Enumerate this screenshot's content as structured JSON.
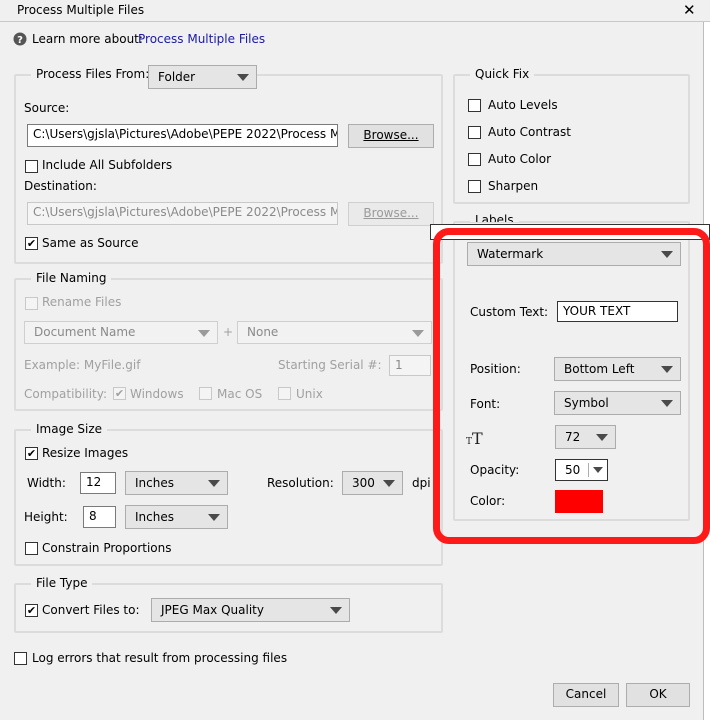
{
  "window": {
    "title": "Process Multiple Files",
    "close_glyph": "✕"
  },
  "help": {
    "prefix": "Learn more about:",
    "link": "Process Multiple Files",
    "icon": "question-circle-icon"
  },
  "process_from": {
    "legend": "Process Files From:",
    "selected": "Folder",
    "source_label": "Source:",
    "source_value": "C:\\Users\\gjsla\\Pictures\\Adobe\\PEPE 2022\\Process Mult",
    "browse_label": "Browse...",
    "include_subfolders": "Include All Subfolders",
    "destination_label": "Destination:",
    "destination_value": "C:\\Users\\gjsla\\Pictures\\Adobe\\PEPE 2022\\Process Mult",
    "same_as_source": "Same as Source"
  },
  "file_naming": {
    "legend": "File Naming",
    "rename_files": "Rename Files",
    "name_option": "Document Name",
    "plus": "+",
    "second_option": "None",
    "example": "Example: MyFile.gif",
    "serial_label": "Starting Serial #:",
    "serial_value": "1",
    "compat_label": "Compatibility:",
    "windows": "Windows",
    "macos": "Mac OS",
    "unix": "Unix"
  },
  "image_size": {
    "legend": "Image Size",
    "resize_images": "Resize Images",
    "width_label": "Width:",
    "width_value": "12",
    "width_unit": "Inches",
    "height_label": "Height:",
    "height_value": "8",
    "height_unit": "Inches",
    "resolution_label": "Resolution:",
    "resolution_value": "300",
    "resolution_unit": "dpi",
    "constrain": "Constrain Proportions"
  },
  "file_type": {
    "legend": "File Type",
    "convert_label": "Convert Files to:",
    "format": "JPEG Max Quality"
  },
  "log_errors": "Log errors that result from processing files",
  "quick_fix": {
    "legend": "Quick Fix",
    "items": [
      "Auto Levels",
      "Auto Contrast",
      "Auto Color",
      "Sharpen"
    ]
  },
  "labels": {
    "legend": "Labels",
    "type": "Watermark",
    "custom_text_label": "Custom Text:",
    "custom_text_value": "YOUR TEXT",
    "position_label": "Position:",
    "position_value": "Bottom Left",
    "font_label": "Font:",
    "font_value": "Symbol",
    "font_size_value": "72",
    "opacity_label": "Opacity:",
    "opacity_value": "50",
    "color_label": "Color:",
    "color_value": "#ff0000",
    "highlight_color": "#ff1a1a"
  },
  "buttons": {
    "cancel": "Cancel",
    "ok": "OK"
  },
  "check_glyph": "✔"
}
